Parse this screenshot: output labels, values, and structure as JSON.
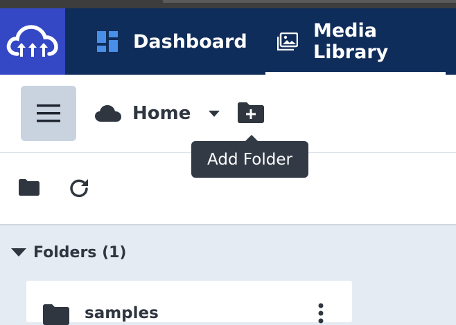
{
  "nav": {
    "items": [
      {
        "label": "Dashboard",
        "icon": "dashboard-icon"
      },
      {
        "label": "Media Library",
        "icon": "media-library-icon",
        "active": true
      }
    ]
  },
  "toolbar": {
    "home_label": "Home",
    "add_folder_tooltip": "Add Folder"
  },
  "folders": {
    "header": "Folders (1)",
    "items": [
      {
        "name": "samples"
      }
    ]
  },
  "colors": {
    "navbar": "#0f2d5a",
    "logo_bg": "#3448c5",
    "content_bg": "#e5ebf2",
    "tooltip_bg": "#323a45"
  }
}
